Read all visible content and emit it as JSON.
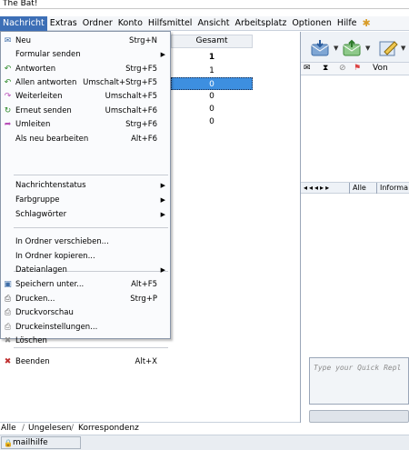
{
  "window": {
    "title": "The Bat!"
  },
  "menubar": {
    "items": [
      "Nachricht",
      "Extras",
      "Ordner",
      "Konto",
      "Hilfsmittel",
      "Ansicht",
      "Arbeitsplatz",
      "Optionen",
      "Hilfe"
    ],
    "active_index": 0
  },
  "message_list": {
    "column_header": "Gesamt",
    "counts": [
      "1",
      "1",
      "0",
      "0",
      "0",
      "0"
    ],
    "selected_index": 2
  },
  "dropdown": {
    "items": [
      {
        "label": "Neu",
        "shortcut": "Strg+N",
        "icon": "new-message-icon"
      },
      {
        "label": "Formular senden",
        "submenu": true
      },
      {
        "label": "Antworten",
        "shortcut": "Strg+F5",
        "icon": "reply-icon"
      },
      {
        "label": "Allen antworten",
        "shortcut": "Umschalt+Strg+F5",
        "icon": "reply-all-icon"
      },
      {
        "label": "Weiterleiten",
        "shortcut": "Umschalt+F5",
        "icon": "forward-icon"
      },
      {
        "label": "Erneut senden",
        "shortcut": "Umschalt+F6",
        "icon": "resend-icon"
      },
      {
        "label": "Umleiten",
        "shortcut": "Strg+F6",
        "icon": "redirect-icon"
      },
      {
        "label": "Als neu bearbeiten",
        "shortcut": "Alt+F6"
      },
      {
        "label": "Nachrichtenstatus",
        "submenu": true
      },
      {
        "label": "Farbgruppe",
        "submenu": true
      },
      {
        "label": "Schlagwörter",
        "submenu": true
      },
      {
        "label": "In Ordner verschieben..."
      },
      {
        "label": "In Ordner kopieren..."
      },
      {
        "label": "Dateianlagen",
        "submenu": true
      },
      {
        "label": "Speichern unter...",
        "shortcut": "Alt+F5",
        "icon": "save-icon"
      },
      {
        "label": "Drucken...",
        "shortcut": "Strg+P",
        "icon": "print-icon"
      },
      {
        "label": "Druckvorschau",
        "icon": "print-preview-icon"
      },
      {
        "label": "Druckeinstellungen...",
        "icon": "print-settings-icon"
      },
      {
        "label": "Löschen",
        "icon": "delete-icon"
      },
      {
        "label": "Beenden",
        "shortcut": "Alt+X",
        "icon": "exit-icon"
      }
    ]
  },
  "right_panel": {
    "column_from": "Von",
    "tabs": [
      "Alle",
      "Informa"
    ],
    "quick_reply_placeholder": "Type your Quick Repl"
  },
  "bottom_tabs": [
    "Alle",
    "Ungelesen",
    "Korrespondenz"
  ],
  "status": {
    "account": "mailhilfe"
  },
  "colors": {
    "accent": "#3d6fb6",
    "selection": "#3d8fe0",
    "menu_bg": "#fafbfd"
  }
}
